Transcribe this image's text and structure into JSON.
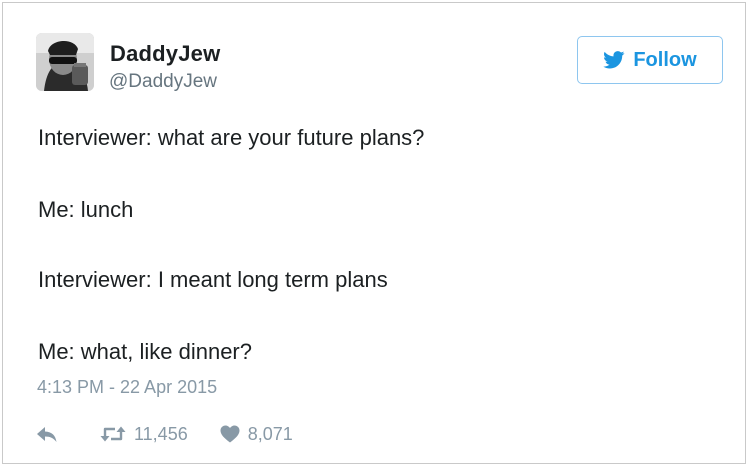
{
  "user": {
    "display_name": "DaddyJew",
    "username": "@DaddyJew"
  },
  "follow_button": {
    "label": "Follow",
    "icon": "twitter-bird-icon",
    "color": "#1b95e0"
  },
  "tweet": {
    "lines": [
      "Interviewer: what are your future plans?",
      "Me: lunch",
      "Interviewer: I meant long term plans",
      "Me: what, like dinner?"
    ],
    "timestamp": "4:13 PM - 22 Apr 2015"
  },
  "actions": {
    "reply_icon": "reply-icon",
    "retweet_icon": "retweet-icon",
    "retweet_count": "11,456",
    "like_icon": "heart-icon",
    "like_count": "8,071"
  }
}
